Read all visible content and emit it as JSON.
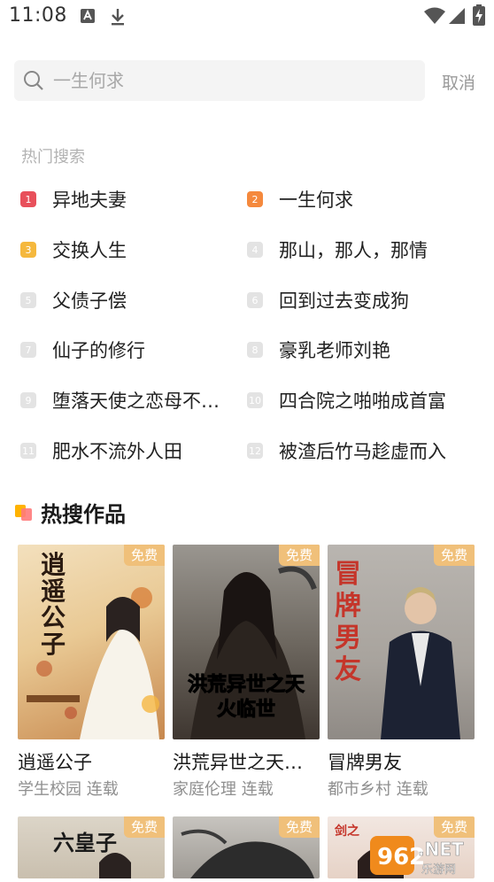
{
  "status_bar": {
    "time": "11:08"
  },
  "search": {
    "placeholder": "一生何求",
    "cancel_label": "取消"
  },
  "hot_search": {
    "label": "热门搜索",
    "items": [
      {
        "rank": "1",
        "text": "异地夫妻",
        "badge_color": "#e8505b"
      },
      {
        "rank": "2",
        "text": "一生何求",
        "badge_color": "#f5893d"
      },
      {
        "rank": "3",
        "text": "交换人生",
        "badge_color": "#f5b83d"
      },
      {
        "rank": "4",
        "text": "那山，那人，那情",
        "badge_color": "#e3e3e3"
      },
      {
        "rank": "5",
        "text": "父债子偿",
        "badge_color": "#e3e3e3"
      },
      {
        "rank": "6",
        "text": "回到过去变成狗",
        "badge_color": "#e3e3e3"
      },
      {
        "rank": "7",
        "text": "仙子的修行",
        "badge_color": "#e3e3e3"
      },
      {
        "rank": "8",
        "text": "豪乳老师刘艳",
        "badge_color": "#e3e3e3"
      },
      {
        "rank": "9",
        "text": "堕落天使之恋母不…",
        "badge_color": "#e3e3e3"
      },
      {
        "rank": "10",
        "text": "四合院之啪啪成首富",
        "badge_color": "#e3e3e3"
      },
      {
        "rank": "11",
        "text": "肥水不流外人田",
        "badge_color": "#e3e3e3"
      },
      {
        "rank": "12",
        "text": "被渣后竹马趁虚而入",
        "badge_color": "#e3e3e3"
      }
    ]
  },
  "hot_works": {
    "title": "热搜作品",
    "books": [
      {
        "title": "逍遥公子",
        "meta": "学生校园 连载",
        "badge": "免费",
        "cover_text": "逍遥公子"
      },
      {
        "title": "洪荒异世之天…",
        "meta": "家庭伦理 连载",
        "badge": "免费",
        "cover_text": "洪荒异世之天火临世"
      },
      {
        "title": "冒牌男友",
        "meta": "都市乡村 连载",
        "badge": "免费",
        "cover_text": "冒牌男友"
      },
      {
        "badge": "免费",
        "cover_text": "六皇子"
      },
      {
        "badge": "免费"
      },
      {
        "badge": "免费",
        "cover_text": "剑之"
      }
    ]
  },
  "watermark": {
    "text": "962.NET",
    "subtext": "乐游网"
  }
}
